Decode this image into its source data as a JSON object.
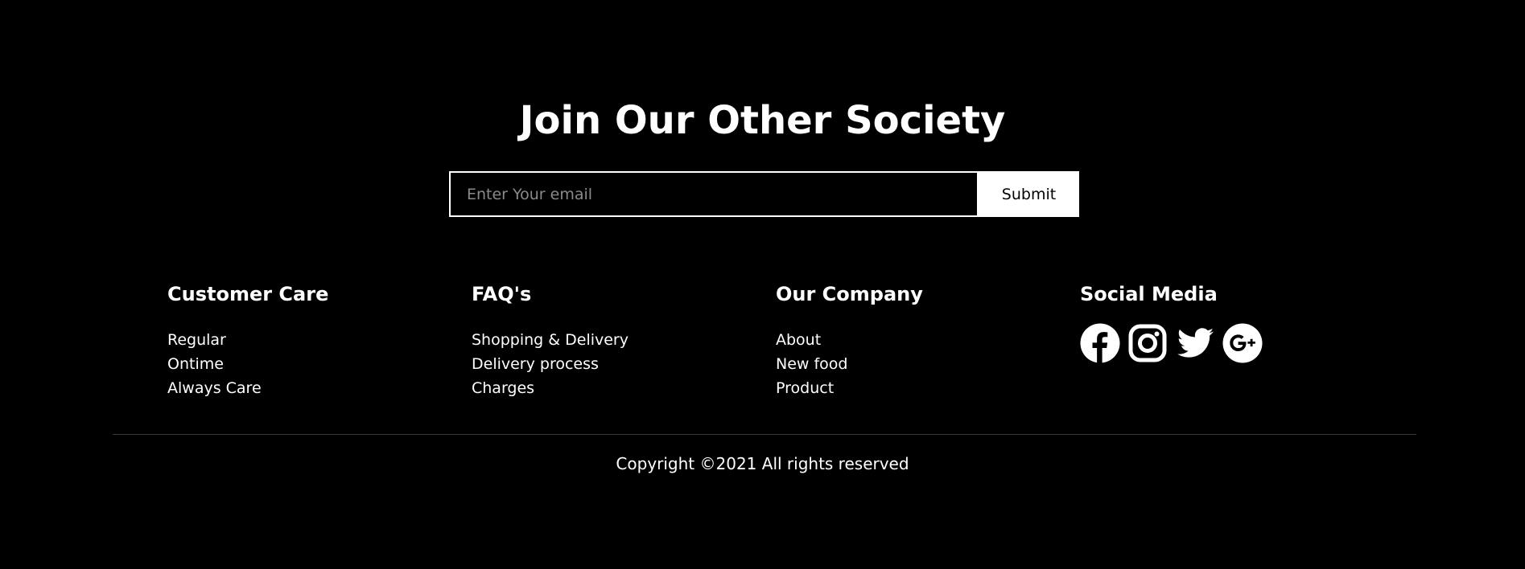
{
  "newsletter": {
    "title": "Join Our Other Society",
    "email_placeholder": "Enter Your email",
    "email_value": "",
    "submit_label": "Submit"
  },
  "columns": {
    "customer_care": {
      "heading": "Customer Care",
      "links": [
        "Regular",
        "Ontime",
        "Always Care"
      ]
    },
    "faqs": {
      "heading": "FAQ's",
      "links": [
        "Shopping & Delivery",
        "Delivery process",
        "Charges"
      ]
    },
    "company": {
      "heading": "Our Company",
      "links": [
        "About",
        "New food",
        "Product"
      ]
    },
    "social": {
      "heading": "Social Media",
      "icons": [
        "facebook-icon",
        "instagram-icon",
        "twitter-icon",
        "google-plus-icon"
      ]
    }
  },
  "footer": {
    "copyright": "Copyright ©2021 All rights reserved"
  },
  "colors": {
    "background": "#000000",
    "text": "#ffffff",
    "divider": "#3a3a3a",
    "placeholder": "#8a8a8a"
  }
}
